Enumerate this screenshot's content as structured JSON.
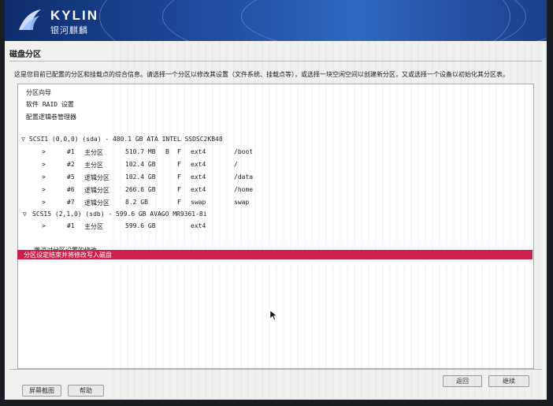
{
  "banner": {
    "brand": "KYLIN",
    "brand_cn": "银河麒麟"
  },
  "section": {
    "title": "磁盘分区",
    "description": "这是您目前已配置的分区和挂载点的综合信息。请选择一个分区以修改其设置（文件系统、挂载点等），或选择一块空闲空间以创建新分区，又或选择一个设备以初始化其分区表。"
  },
  "menu": [
    {
      "label": "分区向导"
    },
    {
      "label": "软件 RAID 设置"
    },
    {
      "label": "配置逻辑卷管理器"
    }
  ],
  "disks": [
    {
      "label": "SCSI1 (0,0,0) (sda) - 480.1 GB ATA INTEL SSDSC2KB48",
      "partitions": [
        {
          "num": "#1",
          "type": "主分区",
          "size": "510.7 MB",
          "flag1": "B",
          "flag2": "F",
          "fs": "ext4",
          "mount": "/boot"
        },
        {
          "num": "#2",
          "type": "主分区",
          "size": "102.4 GB",
          "flag1": "",
          "flag2": "F",
          "fs": "ext4",
          "mount": "/"
        },
        {
          "num": "#5",
          "type": "逻辑分区",
          "size": "102.4 GB",
          "flag1": "",
          "flag2": "F",
          "fs": "ext4",
          "mount": "/data"
        },
        {
          "num": "#6",
          "type": "逻辑分区",
          "size": "266.6 GB",
          "flag1": "",
          "flag2": "F",
          "fs": "ext4",
          "mount": "/home"
        },
        {
          "num": "#7",
          "type": "逻辑分区",
          "size": "8.2 GB",
          "flag1": "",
          "flag2": "F",
          "fs": "swap",
          "mount": "swap"
        }
      ]
    },
    {
      "label": "SCSI5 (2,1,0) (sdb) - 599.6 GB AVAGO MR9361-8i",
      "partitions": [
        {
          "num": "#1",
          "type": "主分区",
          "size": "599.6 GB",
          "flag1": "",
          "flag2": "",
          "fs": "ext4",
          "mount": ""
        }
      ]
    }
  ],
  "actions": {
    "undo": "撤消对分区设置的修改",
    "finish": "分区设定结束并将修改写入磁盘"
  },
  "buttons": {
    "screenshot": "屏幕截图",
    "help": "帮助",
    "back": "返回",
    "continue": "继续"
  },
  "colors": {
    "banner": "#1d4a9c",
    "highlight": "#cf1f4a"
  }
}
